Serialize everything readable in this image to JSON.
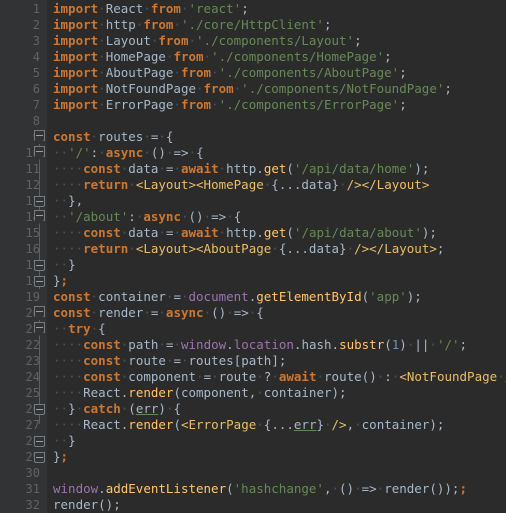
{
  "editor": {
    "theme_name": "darcula",
    "background": "#2b2b2b",
    "gutter_background": "#313335",
    "line_number_color": "#606366",
    "default_text_color": "#a9b7c6",
    "keyword_color": "#cc7832",
    "string_color": "#6a8759",
    "number_color": "#6897bb",
    "function_color": "#ffc66d",
    "global_color": "#9876aa",
    "jsx_tag_color": "#e8bf6a",
    "total_lines": 32,
    "language": "JavaScript JSX"
  },
  "line_numbers": [
    "1",
    "2",
    "3",
    "4",
    "5",
    "6",
    "7",
    "8",
    "9",
    "10",
    "11",
    "12",
    "13",
    "14",
    "15",
    "16",
    "17",
    "18",
    "19",
    "20",
    "21",
    "22",
    "23",
    "24",
    "25",
    "26",
    "27",
    "28",
    "29",
    "30",
    "31",
    "32"
  ],
  "code_lines": [
    {
      "n": "1",
      "text": "import React from 'react';"
    },
    {
      "n": "2",
      "text": "import http from './core/HttpClient';"
    },
    {
      "n": "3",
      "text": "import Layout from './components/Layout';"
    },
    {
      "n": "4",
      "text": "import HomePage from './components/HomePage';"
    },
    {
      "n": "5",
      "text": "import AboutPage from './components/AboutPage';"
    },
    {
      "n": "6",
      "text": "import NotFoundPage from './components/NotFoundPage';"
    },
    {
      "n": "7",
      "text": "import ErrorPage from './components/ErrorPage';"
    },
    {
      "n": "8",
      "text": ""
    },
    {
      "n": "9",
      "text": "const routes = {"
    },
    {
      "n": "10",
      "text": "  '/': async () => {"
    },
    {
      "n": "11",
      "text": "    const data = await http.get('/api/data/home');"
    },
    {
      "n": "12",
      "text": "    return <Layout><HomePage {...data} /></Layout>"
    },
    {
      "n": "13",
      "text": "  },"
    },
    {
      "n": "14",
      "text": "  '/about': async () => {"
    },
    {
      "n": "15",
      "text": "    const data = await http.get('/api/data/about');"
    },
    {
      "n": "16",
      "text": "    return <Layout><AboutPage {...data} /></Layout>;"
    },
    {
      "n": "17",
      "text": "  }"
    },
    {
      "n": "18",
      "text": "};"
    },
    {
      "n": "19",
      "text": "const container = document.getElementById('app');"
    },
    {
      "n": "20",
      "text": "const render = async () => {"
    },
    {
      "n": "21",
      "text": "  try {"
    },
    {
      "n": "22",
      "text": "    const path = window.location.hash.substr(1) || '/';"
    },
    {
      "n": "23",
      "text": "    const route = routes[path];"
    },
    {
      "n": "24",
      "text": "    const component = route ? await route() : <NotFoundPage />;"
    },
    {
      "n": "25",
      "text": "    React.render(component, container);"
    },
    {
      "n": "26",
      "text": "  } catch (err) {"
    },
    {
      "n": "27",
      "text": "    React.render(<ErrorPage {...err} />, container);"
    },
    {
      "n": "28",
      "text": "  }"
    },
    {
      "n": "29",
      "text": "};"
    },
    {
      "n": "30",
      "text": ""
    },
    {
      "n": "31",
      "text": "window.addEventListener('hashchange', () => render());"
    },
    {
      "n": "32",
      "text": "render();"
    }
  ],
  "fold_markers": [
    {
      "line": "9",
      "type": "open"
    },
    {
      "line": "10",
      "type": "open"
    },
    {
      "line": "13",
      "type": "end"
    },
    {
      "line": "14",
      "type": "open"
    },
    {
      "line": "17",
      "type": "end"
    },
    {
      "line": "18",
      "type": "end"
    },
    {
      "line": "20",
      "type": "open"
    },
    {
      "line": "21",
      "type": "open"
    },
    {
      "line": "26",
      "type": "end"
    },
    {
      "line": "28",
      "type": "end"
    },
    {
      "line": "29",
      "type": "end"
    }
  ],
  "warnings": [
    {
      "line": "26",
      "token": "err",
      "kind": "unused-variable-underline"
    },
    {
      "line": "27",
      "token": "err",
      "kind": "unused-variable-underline"
    }
  ]
}
